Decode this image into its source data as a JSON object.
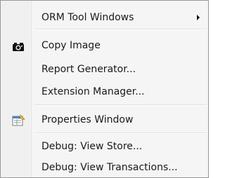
{
  "menu": {
    "items": [
      {
        "label": "ORM Tool Windows",
        "icon": "",
        "has_submenu": true
      },
      {
        "label": "Copy Image",
        "icon": "camera-icon"
      },
      {
        "label": "Report Generator..."
      },
      {
        "label": "Extension Manager..."
      },
      {
        "label": "Properties Window",
        "icon": "properties-window-icon"
      },
      {
        "label": "Debug: View Store..."
      },
      {
        "label": "Debug: View Transactions..."
      }
    ]
  }
}
